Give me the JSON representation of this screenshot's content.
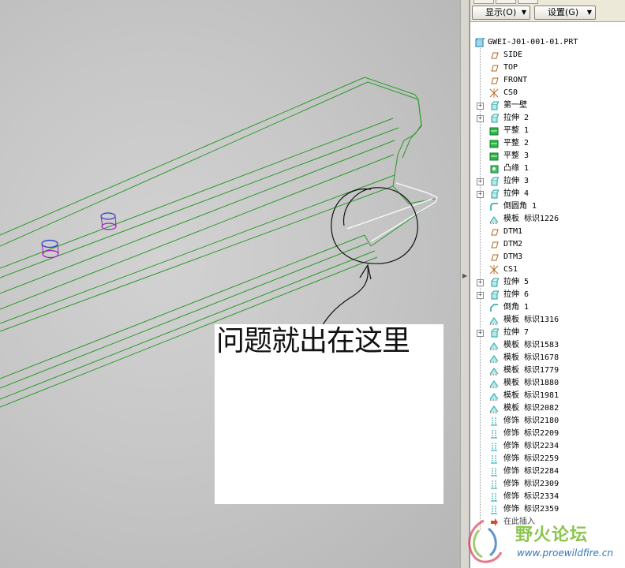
{
  "annotation": {
    "text": "问题就出在这里"
  },
  "toolbar": {
    "show_label": "显示",
    "show_hotkey": "(O)",
    "settings_label": "设置",
    "settings_hotkey": "(G)"
  },
  "model_tree": {
    "root": "GWEI-J01-001-01.PRT",
    "items": [
      {
        "label": "SIDE",
        "icon": "datum-plane-icon",
        "expandable": false
      },
      {
        "label": "TOP",
        "icon": "datum-plane-icon",
        "expandable": false
      },
      {
        "label": "FRONT",
        "icon": "datum-plane-icon",
        "expandable": false
      },
      {
        "label": "CS0",
        "icon": "coordinate-system-icon",
        "expandable": false
      },
      {
        "label": "第一壁",
        "icon": "extrude-icon",
        "expandable": true
      },
      {
        "label": "拉伸 2",
        "icon": "extrude-icon",
        "expandable": true
      },
      {
        "label": "平整 1",
        "icon": "flat-wall-icon",
        "expandable": false
      },
      {
        "label": "平整 2",
        "icon": "flat-wall-icon",
        "expandable": false
      },
      {
        "label": "平整 3",
        "icon": "flat-wall-icon",
        "expandable": false
      },
      {
        "label": "凸缘 1",
        "icon": "flange-icon",
        "expandable": false
      },
      {
        "label": "拉伸 3",
        "icon": "extrude-icon",
        "expandable": true
      },
      {
        "label": "拉伸 4",
        "icon": "extrude-icon",
        "expandable": true
      },
      {
        "label": "倒圆角 1",
        "icon": "round-icon",
        "expandable": false
      },
      {
        "label": "模板 标识1226",
        "icon": "form-icon",
        "expandable": false
      },
      {
        "label": "DTM1",
        "icon": "datum-plane-icon",
        "expandable": false
      },
      {
        "label": "DTM2",
        "icon": "datum-plane-icon",
        "expandable": false
      },
      {
        "label": "DTM3",
        "icon": "datum-plane-icon",
        "expandable": false
      },
      {
        "label": "CS1",
        "icon": "coordinate-system-icon",
        "expandable": false
      },
      {
        "label": "拉伸 5",
        "icon": "extrude-icon",
        "expandable": true
      },
      {
        "label": "拉伸 6",
        "icon": "extrude-icon",
        "expandable": true
      },
      {
        "label": "倒角 1",
        "icon": "chamfer-icon",
        "expandable": false
      },
      {
        "label": "模板 标识1316",
        "icon": "form-icon",
        "expandable": false
      },
      {
        "label": "拉伸 7",
        "icon": "extrude-icon",
        "expandable": true
      },
      {
        "label": "模板 标识1583",
        "icon": "form-icon",
        "expandable": false
      },
      {
        "label": "模板 标识1678",
        "icon": "form-icon",
        "expandable": false
      },
      {
        "label": "模板 标识1779",
        "icon": "form-icon",
        "expandable": false
      },
      {
        "label": "模板 标识1880",
        "icon": "form-icon",
        "expandable": false
      },
      {
        "label": "模板 标识1981",
        "icon": "form-icon",
        "expandable": false
      },
      {
        "label": "模板 标识2082",
        "icon": "form-icon",
        "expandable": false
      },
      {
        "label": "修饰 标识2180",
        "icon": "cosmetic-icon",
        "expandable": false
      },
      {
        "label": "修饰 标识2209",
        "icon": "cosmetic-icon",
        "expandable": false
      },
      {
        "label": "修饰 标识2234",
        "icon": "cosmetic-icon",
        "expandable": false
      },
      {
        "label": "修饰 标识2259",
        "icon": "cosmetic-icon",
        "expandable": false
      },
      {
        "label": "修饰 标识2284",
        "icon": "cosmetic-icon",
        "expandable": false
      },
      {
        "label": "修饰 标识2309",
        "icon": "cosmetic-icon",
        "expandable": false
      },
      {
        "label": "修饰 标识2334",
        "icon": "cosmetic-icon",
        "expandable": false
      },
      {
        "label": "修饰 标识2359",
        "icon": "cosmetic-icon",
        "expandable": false
      },
      {
        "label": "在此插入",
        "icon": "insert-here-icon",
        "expandable": false
      }
    ]
  },
  "watermark": {
    "title": "野火论坛",
    "url": "www.proewildfire.cn"
  },
  "colors": {
    "edge_green": "#2a9a2a",
    "hole_magenta": "#a020c0",
    "hole_blue": "#2040d0",
    "icon_teal": "#1aa3a3",
    "watermark_green": "#7fbf3a",
    "watermark_blue": "#1e66b5"
  }
}
